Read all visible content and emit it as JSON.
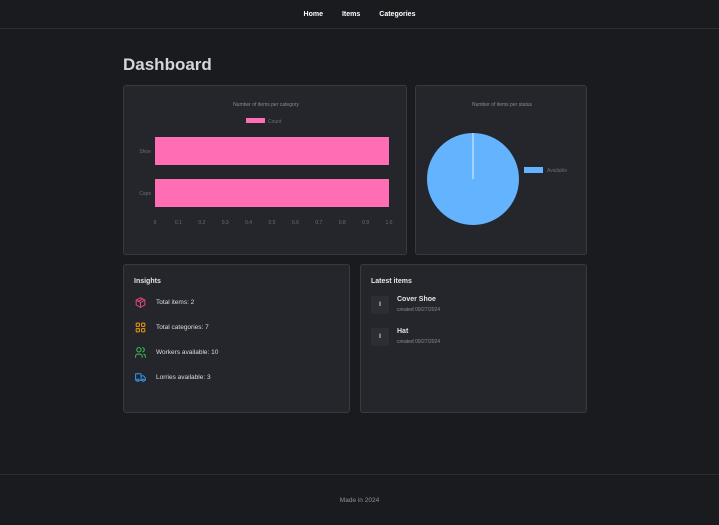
{
  "nav": {
    "items": [
      "Home",
      "Items",
      "Categories"
    ]
  },
  "page": {
    "title": "Dashboard"
  },
  "charts": {
    "category": {
      "title": "Number of items per category",
      "legend_label": "Count"
    },
    "status": {
      "title": "Number of items per status",
      "legend_label": "Available"
    }
  },
  "chart_data": [
    {
      "type": "bar",
      "orientation": "horizontal",
      "title": "Number of items per category",
      "categories": [
        "Shoe",
        "Caps"
      ],
      "series": [
        {
          "name": "Count",
          "values": [
            1,
            1
          ]
        }
      ],
      "xlim": [
        0,
        1.0
      ],
      "x_ticks": [
        "0",
        "0.1",
        "0.2",
        "0.3",
        "0.4",
        "0.5",
        "0.6",
        "0.7",
        "0.8",
        "0.9",
        "1.0"
      ],
      "legend": "top",
      "color": "#ff6eb4"
    },
    {
      "type": "pie",
      "title": "Number of items per status",
      "labels": [
        "Available"
      ],
      "values": [
        2
      ],
      "legend": "right",
      "color": "#63b3ff"
    }
  ],
  "insights": {
    "title": "Insights",
    "rows": [
      {
        "icon": "box-icon",
        "text": "Total items: 2",
        "color": "#e64980"
      },
      {
        "icon": "category-icon",
        "text": "Total categories: 7",
        "color": "#f59f00"
      },
      {
        "icon": "users-icon",
        "text": "Workers available: 10",
        "color": "#40c057"
      },
      {
        "icon": "truck-icon",
        "text": "Lorries available: 3",
        "color": "#339af0"
      }
    ]
  },
  "latest": {
    "title": "Latest items",
    "items": [
      {
        "initial": "I",
        "name": "Cover Shoe",
        "date": "created 09/27/2024"
      },
      {
        "initial": "I",
        "name": "Hat",
        "date": "created 09/27/2024"
      }
    ]
  },
  "footer": {
    "text": "Made in 2024"
  }
}
